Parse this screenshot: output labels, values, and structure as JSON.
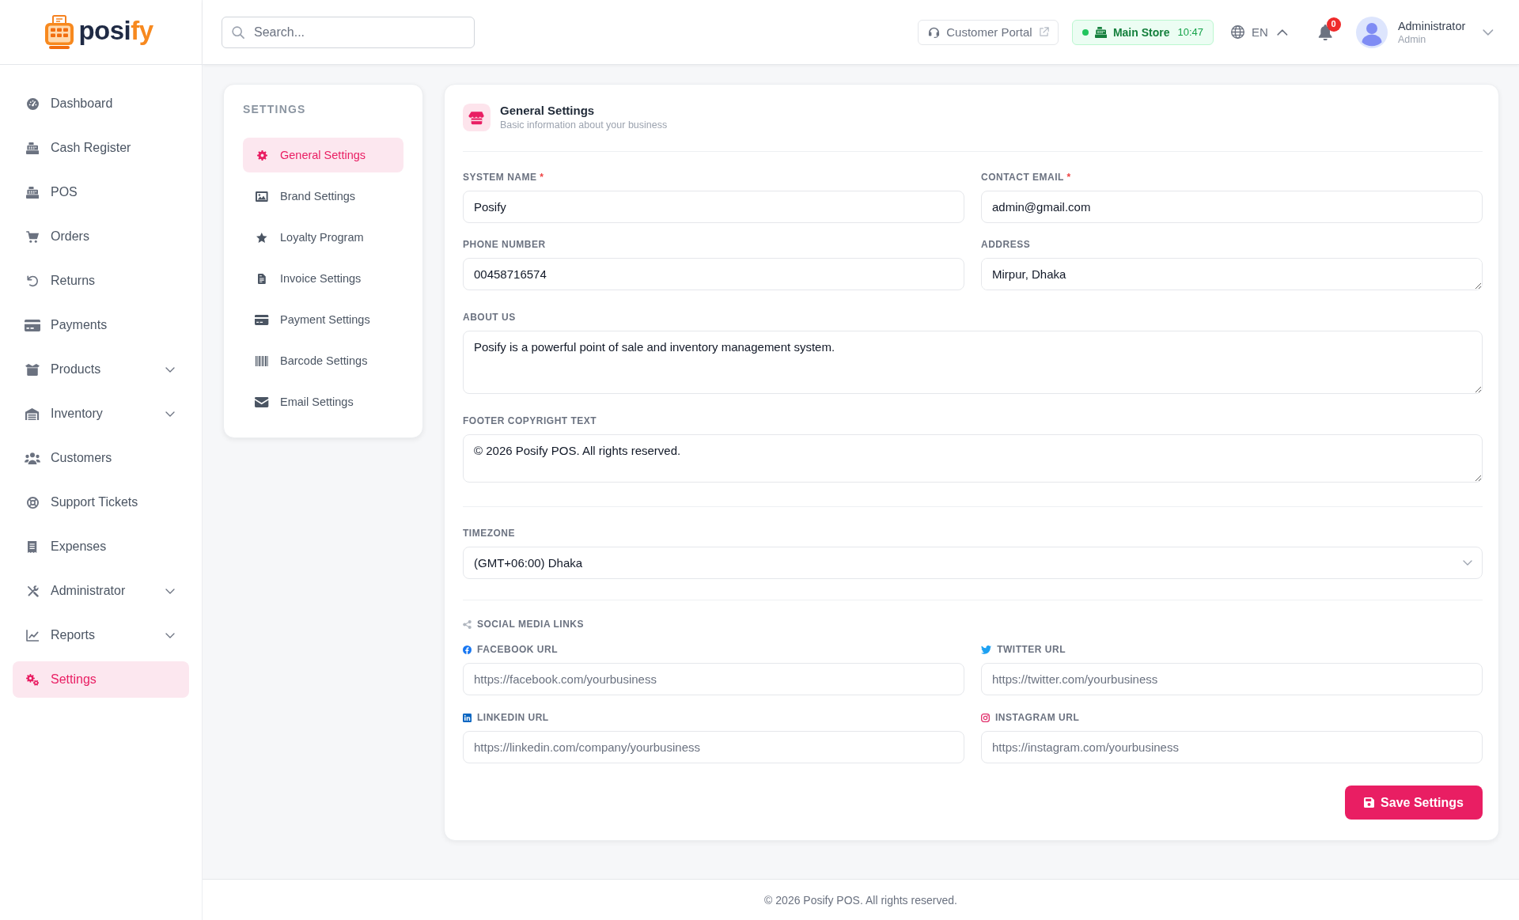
{
  "logo": {
    "parts": [
      {
        "text": "posi",
        "accent": false
      },
      {
        "text": "fy",
        "accent": true
      }
    ]
  },
  "sidebar": {
    "items": [
      {
        "label": "Dashboard",
        "selected": false,
        "expandable": false
      },
      {
        "label": "Cash Register",
        "selected": false,
        "expandable": false
      },
      {
        "label": "POS",
        "selected": false,
        "expandable": false
      },
      {
        "label": "Orders",
        "selected": false,
        "expandable": false
      },
      {
        "label": "Returns",
        "selected": false,
        "expandable": false
      },
      {
        "label": "Payments",
        "selected": false,
        "expandable": false
      },
      {
        "label": "Products",
        "selected": false,
        "expandable": true
      },
      {
        "label": "Inventory",
        "selected": false,
        "expandable": true
      },
      {
        "label": "Customers",
        "selected": false,
        "expandable": false
      },
      {
        "label": "Support Tickets",
        "selected": false,
        "expandable": false
      },
      {
        "label": "Expenses",
        "selected": false,
        "expandable": false
      },
      {
        "label": "Administrator",
        "selected": false,
        "expandable": true
      },
      {
        "label": "Reports",
        "selected": false,
        "expandable": true
      },
      {
        "label": "Settings",
        "selected": true,
        "expandable": false
      }
    ]
  },
  "header": {
    "search": {
      "placeholder": "Search..."
    },
    "customer_portal": {
      "label": "Customer Portal"
    },
    "store": {
      "name": "Main Store",
      "time": "10:47"
    },
    "language": {
      "code": "EN",
      "expanded": true
    },
    "notifications": {
      "count": "0"
    },
    "user": {
      "name": "Administrator",
      "role": "Admin",
      "expanded": false
    }
  },
  "settings_nav": {
    "title": "SETTINGS",
    "items": [
      {
        "label": "General Settings",
        "selected": true
      },
      {
        "label": "Brand Settings",
        "selected": false
      },
      {
        "label": "Loyalty Program",
        "selected": false
      },
      {
        "label": "Invoice Settings",
        "selected": false
      },
      {
        "label": "Payment Settings",
        "selected": false
      },
      {
        "label": "Barcode Settings",
        "selected": false
      },
      {
        "label": "Email Settings",
        "selected": false
      }
    ]
  },
  "general_settings": {
    "title": "General Settings",
    "subtitle": "Basic information about your business",
    "fields": [
      {
        "kind": "input",
        "label": "SYSTEM NAME",
        "required_mark": "*",
        "value": "Posify"
      },
      {
        "kind": "input",
        "label": "CONTACT EMAIL",
        "required_mark": "*",
        "value": "admin@gmail.com"
      },
      {
        "kind": "input",
        "label": "PHONE NUMBER",
        "value": "00458716574"
      },
      {
        "kind": "textarea",
        "label": "ADDRESS",
        "value": "Mirpur, Dhaka"
      }
    ],
    "about_us": {
      "label": "ABOUT US",
      "value": "Posify is a powerful point of sale and inventory management system."
    },
    "footer_copyright": {
      "label": "FOOTER COPYRIGHT TEXT",
      "value": "© 2026 Posify POS. All rights reserved."
    },
    "timezone": {
      "label": "TIMEZONE",
      "value": "(GMT+06:00) Dhaka"
    },
    "social_media": {
      "title": "SOCIAL MEDIA LINKS",
      "fields": [
        {
          "label": "FACEBOOK URL",
          "placeholder": "https://facebook.com/yourbusiness"
        },
        {
          "label": "TWITTER URL",
          "placeholder": "https://twitter.com/yourbusiness"
        },
        {
          "label": "LINKEDIN URL",
          "placeholder": "https://linkedin.com/company/yourbusiness"
        },
        {
          "label": "INSTAGRAM URL",
          "placeholder": "https://instagram.com/yourbusiness"
        }
      ]
    },
    "save_button": {
      "label": "Save Settings"
    }
  },
  "footer": {
    "text": "© 2026 Posify POS. All rights reserved."
  }
}
